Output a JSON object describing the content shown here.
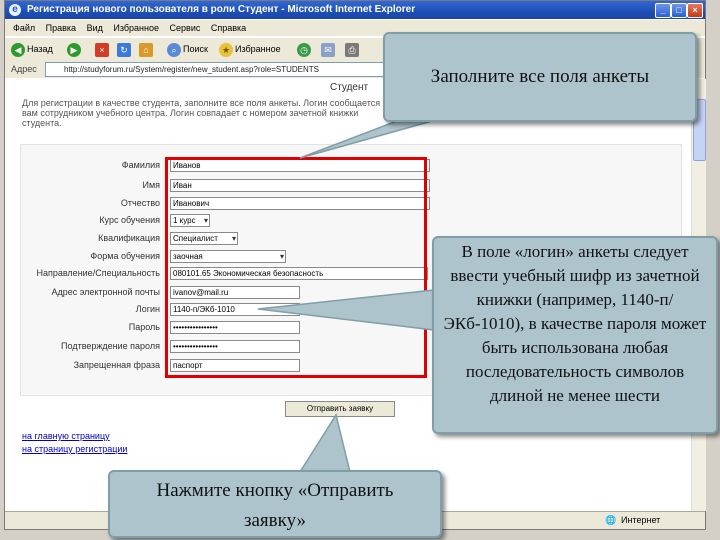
{
  "window": {
    "title": "Регистрация нового пользователя в роли Студент - Microsoft Internet Explorer",
    "controls": [
      "_",
      "□",
      "×"
    ]
  },
  "menu": [
    "Файл",
    "Правка",
    "Вид",
    "Избранное",
    "Сервис",
    "Справка"
  ],
  "toolbar": {
    "back_label": "Назад",
    "search_label": "Поиск",
    "favorites_label": "Избранное"
  },
  "address": {
    "label": "Адрес",
    "url": "http://studyforum.ru/System/register/new_student.asp?role=STUDENTS"
  },
  "page": {
    "heading": "Студент",
    "intro": "Для регистрации в качестве студента, заполните все поля анкеты. Логин сообщается вам сотрудником учебного центра. Логин совпадает с номером зачетной книжки студента."
  },
  "form": {
    "fields": [
      {
        "label": "Фамилия",
        "value": "Иванов",
        "type": "text"
      },
      {
        "label": "Имя",
        "value": "Иван",
        "type": "text"
      },
      {
        "label": "Отчество",
        "value": "Иванович",
        "type": "text"
      },
      {
        "label": "Курс обучения",
        "value": "1 курс",
        "type": "select"
      },
      {
        "label": "Квалификация",
        "value": "Специалист",
        "type": "select"
      },
      {
        "label": "Форма обучения",
        "value": "заочная",
        "type": "select"
      },
      {
        "label": "Направление/Специальность",
        "value": "080101.65 Экономическая безопасность",
        "type": "text"
      },
      {
        "label": "Адрес электронной почты",
        "value": "ivanov@mail.ru",
        "type": "text"
      },
      {
        "label": "Логин",
        "value": "1140-п/ЭКб-1010",
        "type": "text"
      },
      {
        "label": "Пароль",
        "value": "••••••••••••••••",
        "type": "password"
      },
      {
        "label": "Подтверждение пароля",
        "value": "••••••••••••••••",
        "type": "password"
      },
      {
        "label": "Запрещенная фраза",
        "value": "паспорт",
        "type": "text"
      }
    ],
    "submit_label": "Отправить заявку"
  },
  "links": {
    "home": "на главную страницу",
    "register": "на страницу регистрации"
  },
  "status": {
    "zone": "Интернет"
  },
  "callouts": {
    "fill_all": "Заполните все поля анкеты",
    "login_hint": "В поле «логин» анкеты следует ввести учебный шифр из зачетной книжки (например, 1140-п/ЭКб-1010), в качестве пароля может быть использована любая последовательность символов длиной не менее шести",
    "press_button": "Нажмите кнопку «Отправить заявку»"
  },
  "colors": {
    "callout_bg": "#aec4cc",
    "highlight_border": "#e00000",
    "titlebar": "#1e4fb4"
  }
}
